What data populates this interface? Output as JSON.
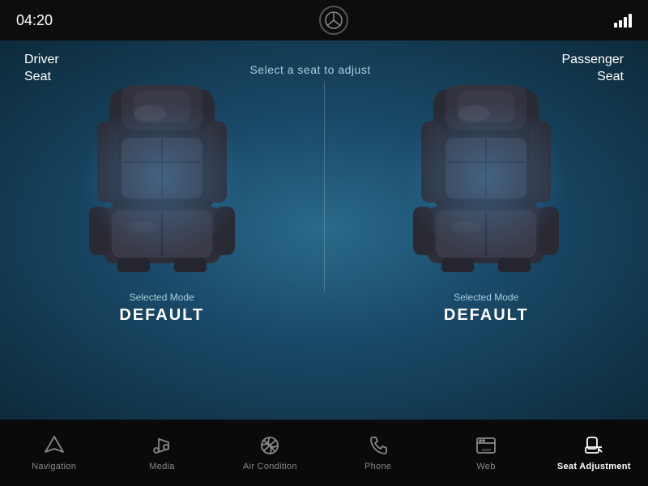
{
  "statusBar": {
    "time": "04:20",
    "logoAlt": "Mercedes-Benz logo"
  },
  "main": {
    "selectPrompt": "Select a seat to adjust",
    "driverSeatLabel": "Driver\nSeat",
    "passengerSeatLabel": "Passenger\nSeat",
    "driverSeat": {
      "modeLabel": "Selected Mode",
      "modeValue": "DEFAULT"
    },
    "passengerSeat": {
      "modeLabel": "Selected Mode",
      "modeValue": "DEFAULT"
    }
  },
  "nav": {
    "items": [
      {
        "id": "navigation",
        "label": "Navigation",
        "active": false
      },
      {
        "id": "media",
        "label": "Media",
        "active": false
      },
      {
        "id": "air-condition",
        "label": "Air Condition",
        "active": false
      },
      {
        "id": "phone",
        "label": "Phone",
        "active": false
      },
      {
        "id": "web",
        "label": "Web",
        "active": false
      },
      {
        "id": "seat-adjustment",
        "label": "Seat Adjustment",
        "active": true
      }
    ]
  }
}
